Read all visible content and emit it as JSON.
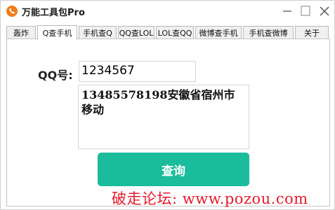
{
  "window": {
    "title": "万能工具包Pro",
    "icon": "phone-icon",
    "accent_color": "#1abc9c",
    "icon_color": "#f07c1b"
  },
  "tabs": [
    {
      "label": "轰炸",
      "active": false
    },
    {
      "label": "Q查手机",
      "active": true
    },
    {
      "label": "手机查Q",
      "active": false
    },
    {
      "label": "QQ查LOL",
      "active": false
    },
    {
      "label": "LOL查QQ",
      "active": false
    },
    {
      "label": "微博查手机",
      "active": false
    },
    {
      "label": "手机查微博",
      "active": false
    },
    {
      "label": "关于",
      "active": false
    }
  ],
  "form": {
    "qq_label": "QQ号:",
    "qq_value": "1234567",
    "result_text": "13485578198安徽省宿州市移动",
    "query_button": "查询"
  },
  "watermark": "破走论坛: www.pozou.com"
}
